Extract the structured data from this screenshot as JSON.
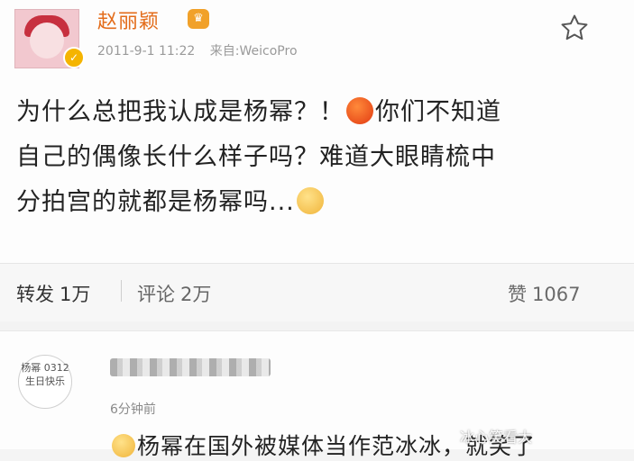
{
  "post": {
    "username": "赵丽颖",
    "timestamp": "2011-9-1 11:22",
    "source": "来自:WeicoPro",
    "content_line1_a": "为什么总把我认成是杨幂？！",
    "content_line1_b": "你们不知道",
    "content_line2": "自己的偶像长什么样子吗？难道大眼睛梳中",
    "content_line3": "分拍宫的就都是杨幂吗...",
    "icons": {
      "vip": "vip-crown-icon",
      "verified": "verified-badge-icon",
      "favorite": "star-icon",
      "emoji1": "angry-face-icon",
      "emoji2": "crying-face-icon"
    }
  },
  "actions": {
    "repost_label": "转发",
    "repost_count": "1万",
    "comment_label": "评论",
    "comment_count": "2万",
    "like_label": "赞",
    "like_count": "1067"
  },
  "comment": {
    "avatar_text": "杨幂 0312 生日快乐",
    "time": "6分钟前",
    "text": "杨幂在国外被媒体当作范冰冰，就笑了"
  },
  "watermark": "冰心笑看大"
}
